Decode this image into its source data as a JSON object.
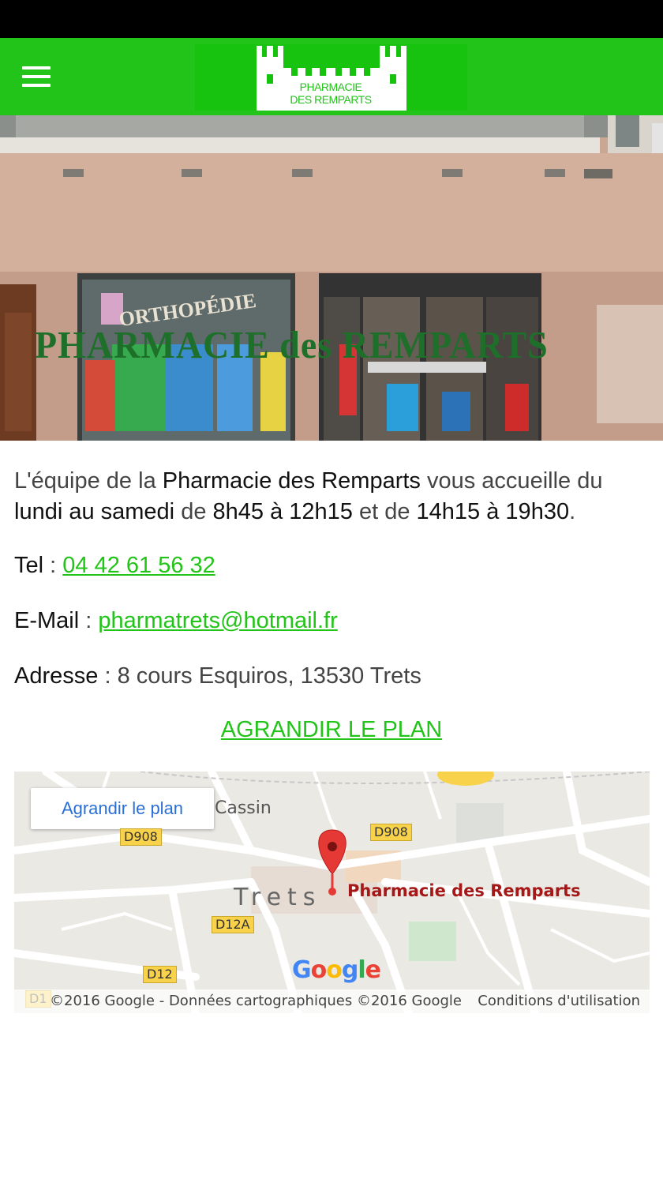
{
  "header": {
    "logo_line1": "PHARMACIE",
    "logo_line2": "DES REMPARTS",
    "menu_icon": "hamburger-menu-icon",
    "color": "#22c419"
  },
  "hero": {
    "sign_text": "PHARMACIE des REMPARTS",
    "window_text": "ORTHOPÉDIE"
  },
  "content": {
    "intro_1": "L'équipe de la ",
    "pharmacy_name": "Pharmacie des Remparts",
    "intro_2": " vous accueille du",
    "days": "lundi au samedi",
    "intro_3": " de ",
    "morning": "8h45 à 12h15",
    "intro_4": " et de ",
    "afternoon": "14h15 à 19h30",
    "intro_5": ".",
    "tel_label": "Tel",
    "tel_sep": " : ",
    "tel_value": "04 42 61 56 32",
    "email_label": "E-Mail",
    "email_sep": " : ",
    "email_value": "pharmatrets@hotmail.fr",
    "address_label": "Adresse",
    "address_sep": " : ",
    "address_value": "8 cours Esquiros, 13530 Trets",
    "plan_link": "AGRANDIR LE PLAN",
    "link_color": "#22c419"
  },
  "map": {
    "enlarge_button": "Agrandir le plan",
    "place_cassin": "Cassin",
    "place_trets": "Trets",
    "road_d908_left": "D908",
    "road_d908_right": "D908",
    "road_d12a": "D12A",
    "road_d12": "D12",
    "road_d1": "D1",
    "marker_label": "Pharmacie des Remparts",
    "google": "Google",
    "copyright": "©2016 Google - Données cartographiques ©2016 Google",
    "terms": "Conditions d'utilisation",
    "marker_color": "#e53935"
  }
}
